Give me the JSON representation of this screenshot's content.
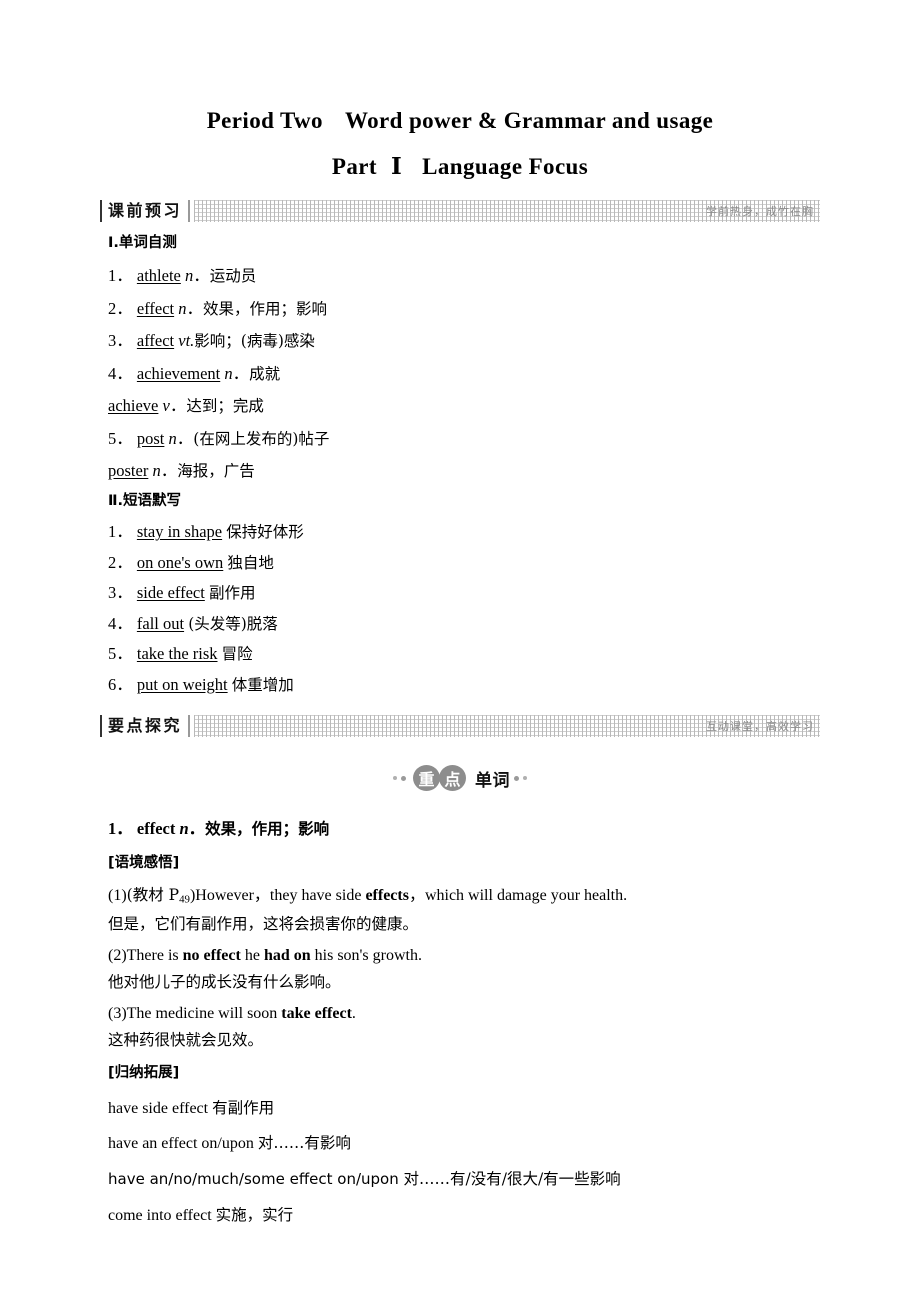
{
  "title": {
    "line1_a": "Period Two",
    "line1_b": "Word power & Grammar and usage",
    "line2_a": "Part",
    "line2_numeral": "Ⅰ",
    "line2_b": "Language Focus"
  },
  "section1": {
    "banner_title": "课前预习",
    "banner_note": "学前热身，成竹在胸",
    "heading_words": "Ⅰ.单词自测",
    "words": [
      {
        "num": "1",
        "term": "athlete",
        "pos": "n",
        "def": "运动员"
      },
      {
        "num": "2",
        "term": "effect",
        "pos": "n",
        "def": "效果，作用；影响"
      },
      {
        "num": "3",
        "term": "affect",
        "pos": "vt.",
        "def": "影响；(病毒)感染"
      },
      {
        "num": "4",
        "term": "achievement",
        "pos": "n",
        "def": "成就"
      },
      {
        "num": "",
        "term": "achieve",
        "pos": "v",
        "def": "达到；完成"
      },
      {
        "num": "5",
        "term": "post",
        "pos": "n",
        "def": "(在网上发布的)帖子"
      },
      {
        "num": "",
        "term": "poster",
        "pos": "n",
        "def": "海报，广告"
      }
    ],
    "heading_phrases": "Ⅱ.短语默写",
    "phrases": [
      {
        "num": "1",
        "term": "stay in shape",
        "def": "保持好体形"
      },
      {
        "num": "2",
        "term": "on one's own",
        "def": "独自地"
      },
      {
        "num": "3",
        "term": "side effect",
        "def": "副作用"
      },
      {
        "num": "4",
        "term": "fall out",
        "def": "(头发等)脱落"
      },
      {
        "num": "5",
        "term": "take the risk",
        "def": "冒险"
      },
      {
        "num": "6",
        "term": "put on weight",
        "def": "体重增加"
      }
    ]
  },
  "section2": {
    "banner_title": "要点探究",
    "banner_note": "互动课堂，高效学习",
    "pill": {
      "oval1": "重",
      "oval2": "点",
      "tail": "单词"
    },
    "entry": {
      "num": "1",
      "term": "effect",
      "pos": "n",
      "def": "效果，作用；影响",
      "sense_heading": "[语境感悟]",
      "examples": [
        {
          "index": "(1)",
          "source_prefix": "(教材 P",
          "source_sub": "49",
          "source_suffix": ")",
          "en_before": "However，they have side ",
          "en_bold": "effects",
          "en_after": "，which will damage your health.",
          "cn": "但是，它们有副作用，这将会损害你的健康。"
        },
        {
          "index": "(2)",
          "en_before": "There is ",
          "en_bold": "no effect",
          "en_mid": " he ",
          "en_bold2": "had on",
          "en_after": " his son's growth.",
          "cn": "他对他儿子的成长没有什么影响。"
        },
        {
          "index": "(3)",
          "en_before": "The medicine will soon ",
          "en_bold": "take effect",
          "en_after": ".",
          "cn": "这种药很快就会见效。"
        }
      ],
      "ext_heading": "[归纳拓展]",
      "extensions": [
        {
          "en": "have side effect ",
          "cn": "有副作用",
          "sans": false
        },
        {
          "en": "have an effect on/upon ",
          "cn": "对……有影响",
          "sans": false
        },
        {
          "en": "have an/no/much/some effect on/upon ",
          "cn": "对……有/没有/很大/有一些影响",
          "sans": true
        },
        {
          "en": "come into effect ",
          "cn": "实施，实行",
          "sans": false
        }
      ]
    }
  }
}
